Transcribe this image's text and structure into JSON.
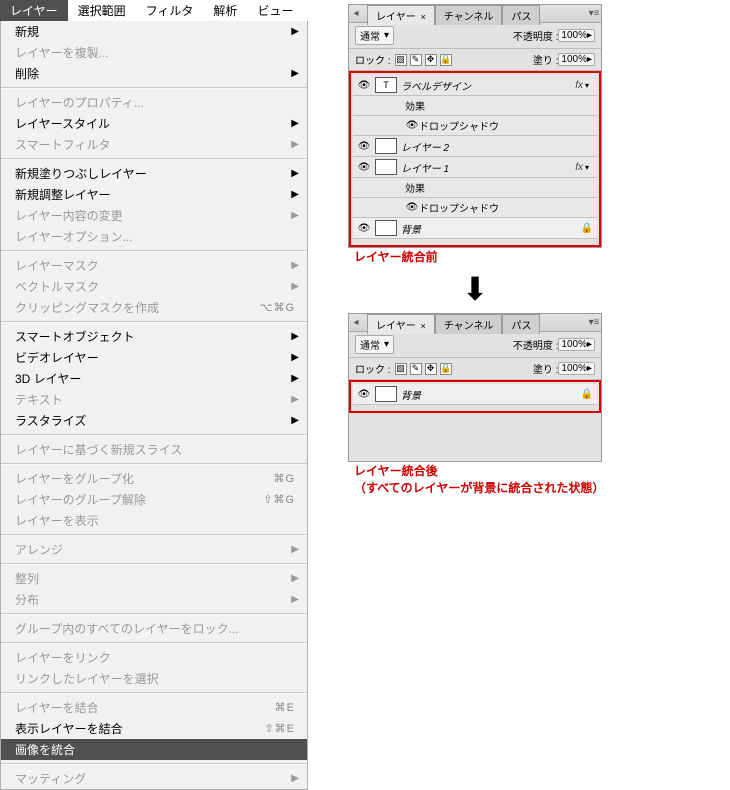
{
  "menubar": [
    "レイヤー",
    "選択範囲",
    "フィルタ",
    "解析",
    "ビュー"
  ],
  "menu": [
    {
      "label": "新規",
      "sub": true
    },
    {
      "label": "レイヤーを複製...",
      "disabled": true
    },
    {
      "label": "削除",
      "sub": true
    },
    {
      "sep": true
    },
    {
      "label": "レイヤーのプロパティ...",
      "disabled": true
    },
    {
      "label": "レイヤースタイル",
      "sub": true
    },
    {
      "label": "スマートフィルタ",
      "sub": true,
      "disabled": true
    },
    {
      "sep": true
    },
    {
      "label": "新規塗りつぶしレイヤー",
      "sub": true
    },
    {
      "label": "新規調整レイヤー",
      "sub": true
    },
    {
      "label": "レイヤー内容の変更",
      "sub": true,
      "disabled": true
    },
    {
      "label": "レイヤーオプション...",
      "disabled": true
    },
    {
      "sep": true
    },
    {
      "label": "レイヤーマスク",
      "sub": true,
      "disabled": true
    },
    {
      "label": "ベクトルマスク",
      "sub": true,
      "disabled": true
    },
    {
      "label": "クリッピングマスクを作成",
      "sc": "⌥⌘G",
      "disabled": true
    },
    {
      "sep": true
    },
    {
      "label": "スマートオブジェクト",
      "sub": true
    },
    {
      "label": "ビデオレイヤー",
      "sub": true
    },
    {
      "label": "3D レイヤー",
      "sub": true
    },
    {
      "label": "テキスト",
      "sub": true,
      "disabled": true
    },
    {
      "label": "ラスタライズ",
      "sub": true
    },
    {
      "sep": true
    },
    {
      "label": "レイヤーに基づく新規スライス",
      "disabled": true
    },
    {
      "sep": true
    },
    {
      "label": "レイヤーをグループ化",
      "sc": "⌘G",
      "disabled": true
    },
    {
      "label": "レイヤーのグループ解除",
      "sc": "⇧⌘G",
      "disabled": true
    },
    {
      "label": "レイヤーを表示",
      "disabled": true
    },
    {
      "sep": true
    },
    {
      "label": "アレンジ",
      "sub": true,
      "disabled": true
    },
    {
      "sep": true
    },
    {
      "label": "整列",
      "sub": true,
      "disabled": true
    },
    {
      "label": "分布",
      "sub": true,
      "disabled": true
    },
    {
      "sep": true
    },
    {
      "label": "グループ内のすべてのレイヤーをロック...",
      "disabled": true
    },
    {
      "sep": true
    },
    {
      "label": "レイヤーをリンク",
      "disabled": true
    },
    {
      "label": "リンクしたレイヤーを選択",
      "disabled": true
    },
    {
      "sep": true
    },
    {
      "label": "レイヤーを結合",
      "sc": "⌘E",
      "disabled": true
    },
    {
      "label": "表示レイヤーを結合",
      "sc": "⇧⌘E"
    },
    {
      "label": "画像を統合",
      "selected": true
    },
    {
      "sep": true
    },
    {
      "label": "マッティング",
      "sub": true,
      "disabled": true
    }
  ],
  "panel": {
    "tabs": [
      "レイヤー",
      "チャンネル",
      "パス"
    ],
    "tab_close": "×",
    "blend": "通常",
    "opacity_label": "不透明度 :",
    "opacity_val": "100%",
    "lock_label": "ロック :",
    "fill_label": "塗り :",
    "fill_val": "100%",
    "layers_before": [
      {
        "vis": true,
        "type": "T",
        "name": "ラベルデザイン",
        "fx": true,
        "open": true,
        "sub": [
          {
            "label": "効果"
          },
          {
            "vis": true,
            "label": "ドロップシャドウ"
          }
        ]
      },
      {
        "vis": true,
        "type": "thumb",
        "name": "レイヤー 2"
      },
      {
        "vis": true,
        "type": "thumb",
        "name": "レイヤー 1",
        "fx": true,
        "open": true,
        "sub": [
          {
            "label": "効果"
          },
          {
            "vis": true,
            "label": "ドロップシャドウ"
          }
        ]
      },
      {
        "vis": true,
        "type": "thumb",
        "name": "背景",
        "locked": true
      }
    ],
    "layers_after": [
      {
        "vis": true,
        "type": "thumb",
        "name": "背景",
        "locked": true
      }
    ]
  },
  "captions": {
    "before": "レイヤー統合前",
    "after1": "レイヤー統合後",
    "after2": "（すべてのレイヤーが背景に統合された状態）"
  }
}
